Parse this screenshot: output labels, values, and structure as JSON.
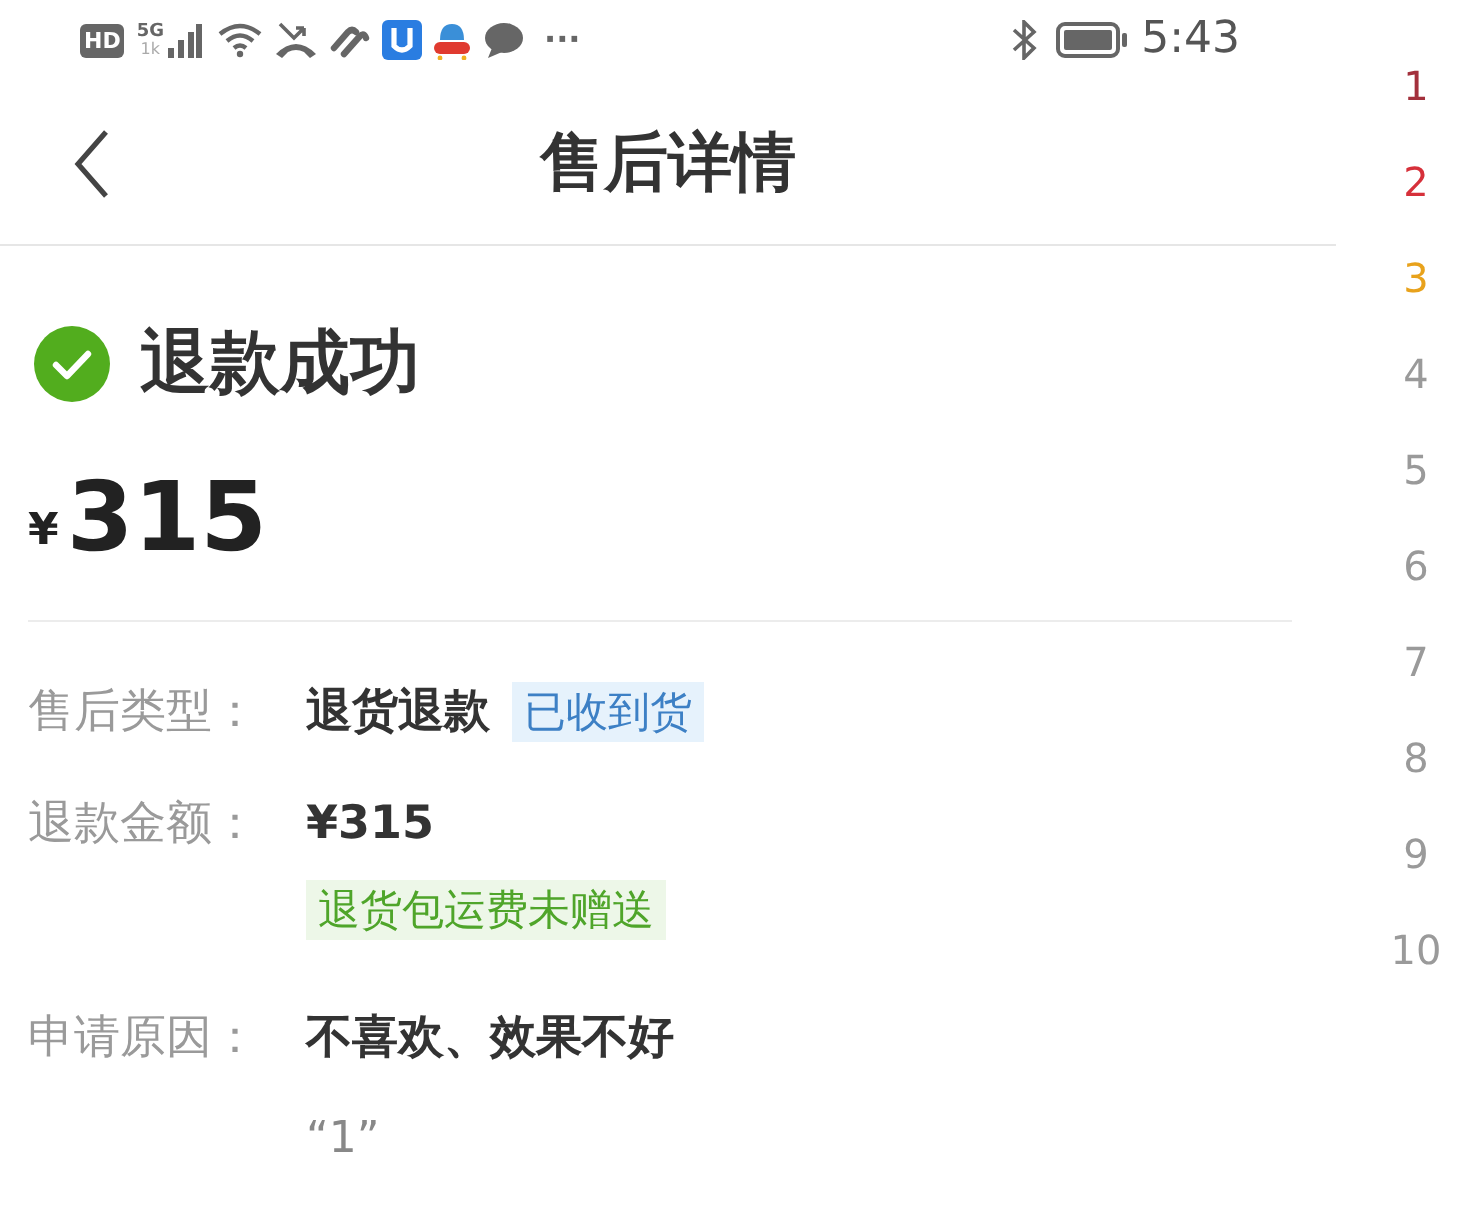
{
  "status_bar": {
    "hd": "HD",
    "network": "5G",
    "speed": "1k",
    "more": "···",
    "time": "5:43"
  },
  "header": {
    "title": "售后详情"
  },
  "status": {
    "kind": "success",
    "title": "退款成功"
  },
  "amount": {
    "currency": "¥",
    "value": "315"
  },
  "details": [
    {
      "label": "售后类型：",
      "value": "退货退款",
      "tag": {
        "text": "已收到货",
        "kind": "info"
      }
    },
    {
      "label": "退款金额：",
      "value": "¥315",
      "sub_tag": {
        "text": "退货包运费未赠送",
        "kind": "success"
      }
    },
    {
      "label": "申请原因：",
      "value": "不喜欢、效果不好",
      "note": "“1”"
    }
  ],
  "index_list": [
    {
      "label": "1",
      "color": "#a3303c"
    },
    {
      "label": "2",
      "color": "#d6303a"
    },
    {
      "label": "3",
      "color": "#e8a21c"
    },
    {
      "label": "4",
      "color": "#9a9a9a"
    },
    {
      "label": "5",
      "color": "#9a9a9a"
    },
    {
      "label": "6",
      "color": "#9a9a9a"
    },
    {
      "label": "7",
      "color": "#9a9a9a"
    },
    {
      "label": "8",
      "color": "#9a9a9a"
    },
    {
      "label": "9",
      "color": "#9a9a9a"
    },
    {
      "label": "10",
      "color": "#9a9a9a"
    }
  ]
}
